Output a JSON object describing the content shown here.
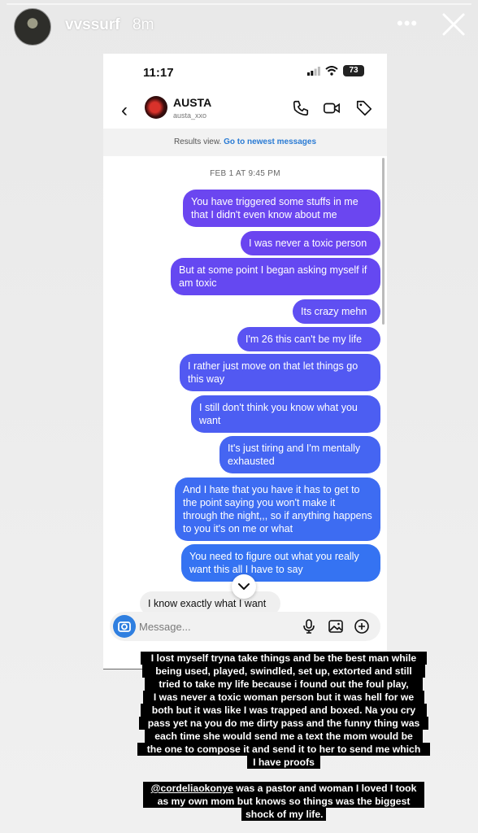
{
  "story": {
    "username": "vvssurf",
    "time_ago": "8m"
  },
  "phone": {
    "clock": "11:17",
    "battery": "73"
  },
  "chat": {
    "contact_name": "AUSTA",
    "contact_handle": "austa_xxo",
    "results_text": "Results view.",
    "results_link": "Go to newest messages",
    "date_separator": "FEB 1 AT 9:45 PM",
    "messages": [
      {
        "text": "You have triggered some stuffs in me that I didn't even know about me",
        "color": "#6b46f0"
      },
      {
        "text": "I was never a toxic person",
        "color": "#6a45f0"
      },
      {
        "text": "But at some point I began asking myself if am toxic",
        "color": "#6548f1"
      },
      {
        "text": "Its crazy mehn",
        "color": "#5f4ff2"
      },
      {
        "text": "I'm 26 this can't be my life",
        "color": "#5a53f2"
      },
      {
        "text": "I rather just move on that let things go this way",
        "color": "#5259f2"
      },
      {
        "text": "I still don't think you know what you want",
        "color": "#4c5ef2"
      },
      {
        "text": "It's just tiring and I'm mentally exhausted",
        "color": "#4565f2"
      },
      {
        "text": "And I hate that you have it has to get to the point saying you won't make it through the night,,, so if anything happens to you it's on me or what",
        "color": "#3d6cf2"
      },
      {
        "text": "You need to figure out what you really want this all I have to say",
        "color": "#3573f2"
      }
    ],
    "received_message": "I know exactly what I want",
    "input_placeholder": "Message..."
  },
  "caption1_lines": [
    "I lost myself tryna take things and be the best man while",
    "being used, played, swindled, set up, extorted and still",
    "tried to take my life because i found out the foul play,",
    "I was never a toxic woman person but it was hell for we",
    "both but it was like I was trapped and boxed. Na you cry",
    "pass yet na you do me dirty pass and the funny thing was",
    "each time she would send me a text the mom would be",
    "the one to compose it and send it to her to send me which",
    "I have proofs"
  ],
  "caption2": {
    "mention": "@cordeliaokonye",
    "line1_rest": " was a pastor and woman I loved I took",
    "line2": "as my own mom but knows so things was the biggest",
    "line3": "shock of my life."
  }
}
